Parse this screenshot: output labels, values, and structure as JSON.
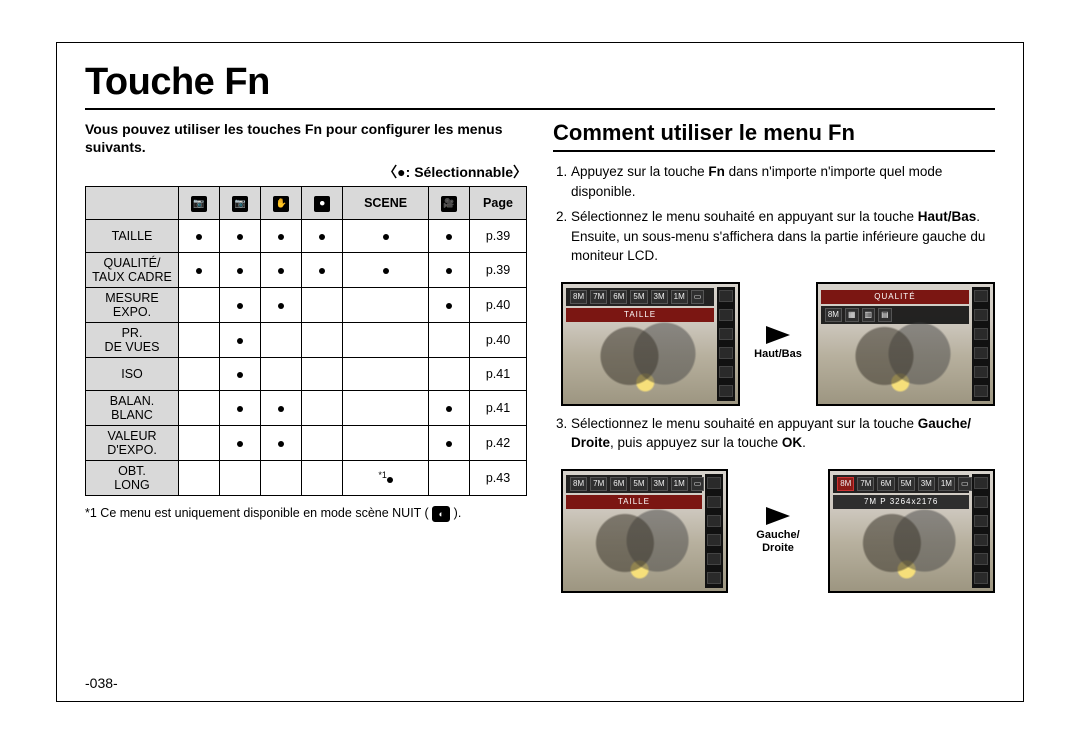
{
  "title": "Touche Fn",
  "left": {
    "intro": "Vous pouvez utiliser les touches Fn pour configurer les menus suivants.",
    "legend_mark": "●",
    "legend_text": ": Sélectionnable",
    "headers": {
      "scene": "SCENE",
      "page": "Page"
    },
    "modes": [
      "📷",
      "📷",
      "✋",
      "⏺",
      "SCENE",
      "🎥"
    ],
    "rows": [
      {
        "label": "TAILLE",
        "cells": [
          "●",
          "●",
          "●",
          "●",
          "●",
          "●"
        ],
        "page": "p.39"
      },
      {
        "label": "QUALITÉ/ TAUX CADRE",
        "cells": [
          "●",
          "●",
          "●",
          "●",
          "●",
          "●"
        ],
        "page": "p.39"
      },
      {
        "label": "MESURE EXPO.",
        "cells": [
          "",
          "●",
          "●",
          "",
          "",
          "●"
        ],
        "page": "p.40"
      },
      {
        "label": "PR. DE VUES",
        "cells": [
          "",
          "●",
          "",
          "",
          "",
          ""
        ],
        "page": "p.40"
      },
      {
        "label": "ISO",
        "cells": [
          "",
          "●",
          "",
          "",
          "",
          ""
        ],
        "page": "p.41"
      },
      {
        "label": "BALAN. BLANC",
        "cells": [
          "",
          "●",
          "●",
          "",
          "",
          "●"
        ],
        "page": "p.41"
      },
      {
        "label": "VALEUR D'EXPO.",
        "cells": [
          "",
          "●",
          "●",
          "",
          "",
          "●"
        ],
        "page": "p.42"
      },
      {
        "label": "OBT. LONG",
        "cells": [
          "",
          "",
          "",
          "",
          "*1●",
          ""
        ],
        "page": "p.43"
      }
    ],
    "footnote": "*1 Ce menu est uniquement disponible en mode scène NUIT ("
  },
  "right": {
    "heading": "Comment utiliser le menu Fn",
    "step1_a": "Appuyez sur la touche ",
    "step1_b": "Fn",
    "step1_c": " dans n'importe n'importe quel mode disponible.",
    "step2_a": "Sélectionnez le menu souhaité en appuyant sur la touche ",
    "step2_b": "Haut/Bas",
    "step2_c": ". Ensuite, un sous-menu s'affichera dans la partie inférieure gauche du moniteur LCD.",
    "step3_a": "Sélectionnez le menu souhaité en appuyant sur la touche ",
    "step3_b": "Gauche/ Droite",
    "step3_c": ", puis appuyez sur la touche ",
    "step3_d": "OK",
    "step3_e": ".",
    "arrow1": "Haut/Bas",
    "arrow2": "Gauche/ Droite",
    "lcd": {
      "topbar_chips": [
        "8M",
        "7M",
        "6M",
        "5M",
        "3M",
        "1M",
        "▭"
      ],
      "taille": "TAILLE",
      "qualite": "QUALITÉ",
      "info": "7M P 3264x2176"
    }
  },
  "pagenum": "-038-"
}
